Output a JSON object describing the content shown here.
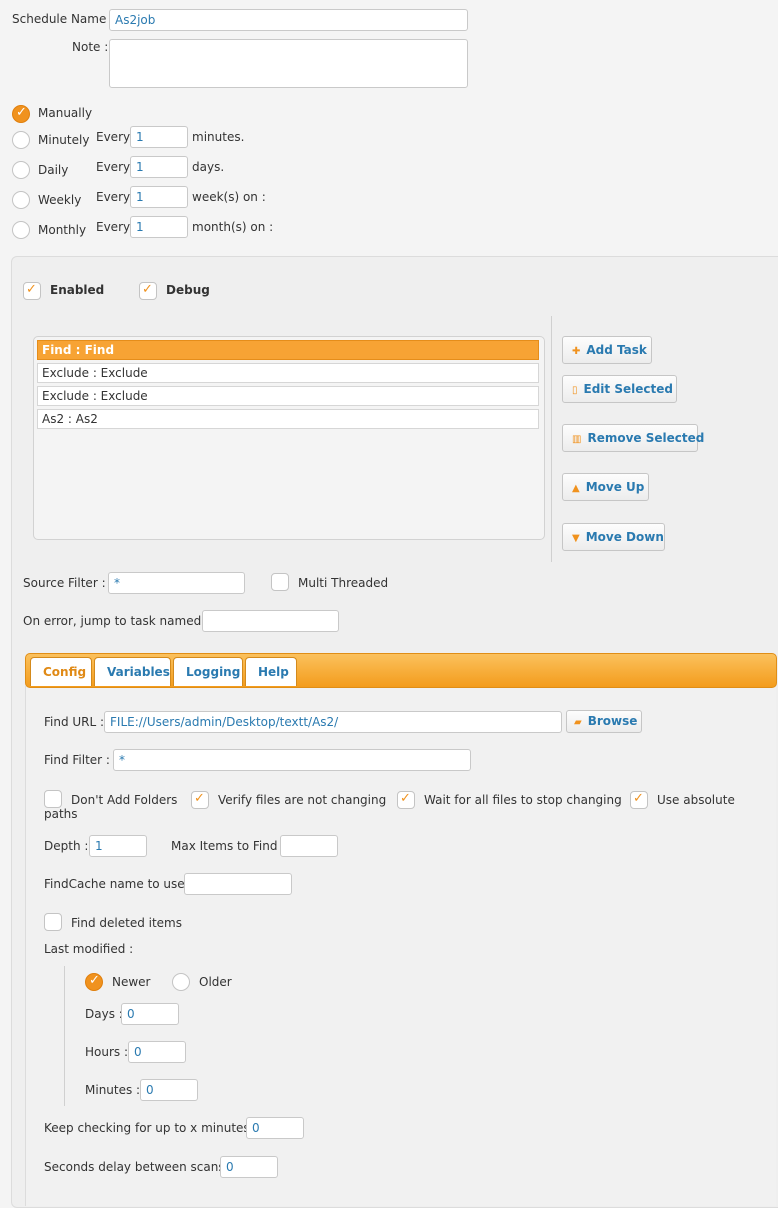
{
  "schedule": {
    "name_label": "Schedule Name :",
    "name_value": "As2job",
    "note_label": "Note :",
    "note_value": ""
  },
  "recurrence": {
    "manually": "Manually",
    "minutely": "Minutely",
    "daily": "Daily",
    "weekly": "Weekly",
    "monthly": "Monthly",
    "every": "Every",
    "minutely_value": "1",
    "daily_value": "1",
    "weekly_value": "1",
    "monthly_value": "1",
    "minutes_unit": "minutes.",
    "days_unit": "days.",
    "weeks_unit": "week(s) on :",
    "months_unit": "month(s) on :",
    "selected": "Manually"
  },
  "flags": {
    "enabled": "Enabled",
    "debug": "Debug"
  },
  "tasks": [
    {
      "label": "Find : Find",
      "selected": true
    },
    {
      "label": "Exclude : Exclude",
      "selected": false
    },
    {
      "label": "Exclude : Exclude",
      "selected": false
    },
    {
      "label": "As2 : As2",
      "selected": false
    }
  ],
  "task_buttons": {
    "add": "Add Task",
    "edit": "Edit Selected",
    "remove": "Remove Selected",
    "up": "Move Up",
    "down": "Move Down"
  },
  "source": {
    "filter_label": "Source Filter :",
    "filter_value": "*",
    "multi_threaded": "Multi Threaded",
    "on_error_label": "On error, jump to task named :",
    "on_error_value": ""
  },
  "tabs": [
    "Config",
    "Variables",
    "Logging",
    "Help"
  ],
  "active_tab": "Config",
  "config": {
    "find_url_label": "Find URL :",
    "find_url_value": "FILE://Users/admin/Desktop/textt/As2/",
    "browse": "Browse",
    "find_filter_label": "Find Filter :",
    "find_filter_value": "*",
    "dont_add_folders": "Don't Add Folders",
    "verify_files": "Verify files are not changing",
    "wait_files": "Wait for all files to stop changing",
    "use_absolute": "Use absolute",
    "paths": "paths",
    "depth_label": "Depth :",
    "depth_value": "1",
    "max_items_label": "Max Items to Find :",
    "max_items_value": "",
    "findcache_label": "FindCache name to use :",
    "findcache_value": "",
    "find_deleted": "Find deleted items",
    "last_modified": "Last modified :",
    "newer": "Newer",
    "older": "Older",
    "days_label": "Days :",
    "days_value": "0",
    "hours_label": "Hours :",
    "hours_value": "0",
    "minutes_label": "Minutes :",
    "minutes_value": "0",
    "keep_checking_label": "Keep checking for up to x minutes :",
    "keep_checking_value": "0",
    "seconds_delay_label": "Seconds delay between scans :",
    "seconds_delay_value": "0"
  },
  "colors": {
    "accent": "#f0921e",
    "link": "#2a7ab0",
    "selected_row": "#f7a334"
  }
}
